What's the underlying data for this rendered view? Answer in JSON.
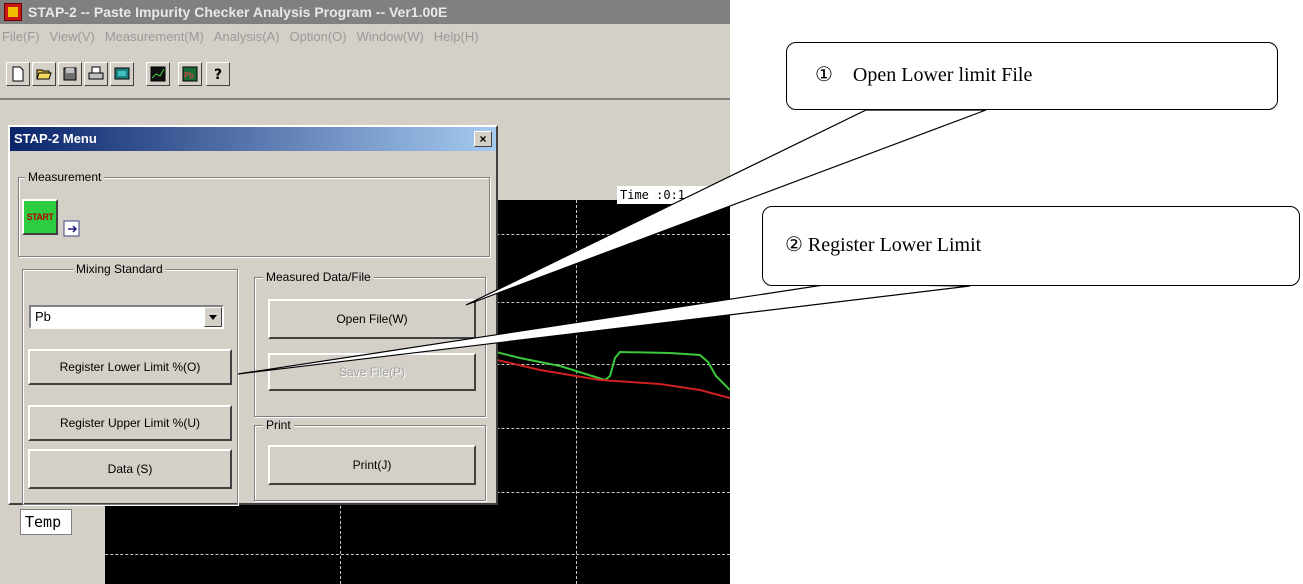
{
  "app": {
    "title": "STAP-2 -- Paste Impurity Checker Analysis Program -- Ver1.00E",
    "menu": [
      "File(F)",
      "View(V)",
      "Measurement(M)",
      "Analysis(A)",
      "Option(O)",
      "Window(W)",
      "Help(H)"
    ],
    "toolbar_icons": [
      "new-file-icon",
      "open-folder-icon",
      "save-icon",
      "print-icon",
      "monitor-icon",
      "chart-icon",
      "pb-icon",
      "help-icon"
    ]
  },
  "graph": {
    "time_label": "Time :0:1",
    "temp_label": "Temp",
    "colors": {
      "background": "#000000",
      "green_curve": "#3cc83c",
      "red_curve": "#d02020",
      "grid": "#c8c8c8"
    }
  },
  "dialog": {
    "title": "STAP-2 Menu",
    "close_label": "×",
    "measurement_group": "Measurement",
    "start_label": "START",
    "mixing_group": "Mixing Standard",
    "mixing_value": "Pb",
    "register_lower": "Register Lower Limit %(O)",
    "register_upper": "Register Upper Limit %(U)",
    "data_button": "Data (S)",
    "measured_group": "Measured Data/File",
    "open_file": "Open File(W)",
    "save_file": "Save File(P)",
    "print_group": "Print",
    "print_button": "Print(J)"
  },
  "callouts": {
    "c1": "①　Open Lower limit File",
    "c2": "②  Register Lower Limit"
  }
}
